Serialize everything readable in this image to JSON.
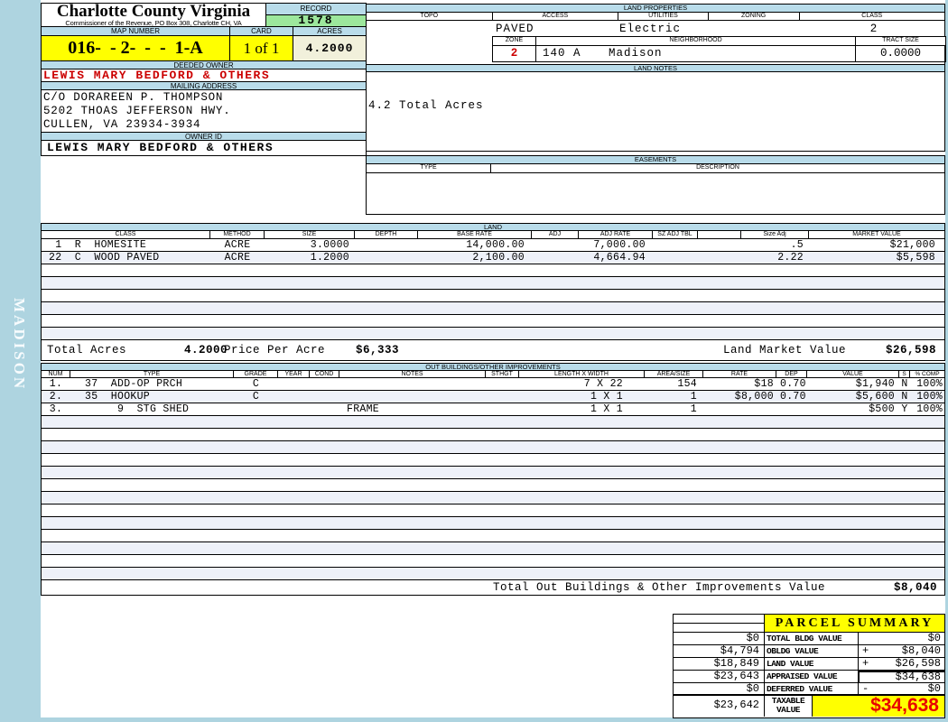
{
  "colors": {
    "page_blue": "#aed4e0",
    "header_strip_blue": "#b9dcea",
    "record_green": "#9ce79c",
    "highlight_yellow": "#ffff00",
    "acres_cream": "#f1f0db",
    "owner_red": "#cc0000",
    "taxable_red": "#e80000",
    "row_stripe": "#eef1f9"
  },
  "sidebar": {
    "district": "MADISON"
  },
  "header": {
    "county": "Charlotte County Virginia",
    "commissioner": "Commissioner of the Revenue, PO Box 308, Charlotte CH, VA",
    "record_label": "RECORD",
    "record_value": "1578",
    "map_number_label": "MAP NUMBER",
    "map_number": "016-  - 2-  -  -  1-A",
    "card_label": "CARD",
    "card_value": "1 of 1",
    "acres_label": "ACRES",
    "acres_value": "4.2000",
    "deeded_owner_label": "DEEDED OWNER",
    "deeded_owner": "LEWIS MARY BEDFORD & OTHERS",
    "mailing_address_label": "MAILING ADDRESS",
    "mailing_address_lines": [
      "C/O DORAREEN P. THOMPSON",
      "5202 THOAS JEFFERSON HWY.",
      "CULLEN, VA 23934-3934"
    ],
    "owner_id_label": "OWNER ID",
    "owner_id": "LEWIS MARY BEDFORD & OTHERS"
  },
  "land_properties": {
    "section_label": "LAND PROPERTIES",
    "headers": [
      "TOPO",
      "ACCESS",
      "UTILITIES",
      "ZONING",
      "CLASS"
    ],
    "topo": "",
    "access": "PAVED",
    "utilities": "Electric",
    "zoning": "",
    "class": "2",
    "zone_label": "ZONE",
    "zone": "2",
    "neighborhood_label": "NEIGHBORHOOD",
    "neighborhood_code": "140 A",
    "neighborhood_name": "Madison",
    "tract_size_label": "TRACT SIZE",
    "tract_size": "0.0000"
  },
  "land_notes": {
    "section_label": "LAND NOTES",
    "note": "4.2 Total Acres"
  },
  "easements": {
    "section_label": "EASEMENTS",
    "type_label": "TYPE",
    "description_label": "DESCRIPTION"
  },
  "land": {
    "section_label": "LAND",
    "headers": [
      "CLASS",
      "METHOD",
      "SIZE",
      "DEPTH",
      "BASE RATE",
      "ADJ",
      "ADJ RATE",
      "SZ ADJ TBL",
      "",
      "Size Adj",
      "MARKET VALUE"
    ],
    "rows": [
      {
        "class": " 1  R  HOMESITE",
        "method": "ACRE",
        "size": "3.0000",
        "depth": "",
        "base_rate": "14,000.00",
        "adj": "",
        "adj_rate": "7,000.00",
        "sz_adj_tbl": "",
        "size_adj": ".5",
        "market_value": "$21,000"
      },
      {
        "class": "22  C  WOOD PAVED",
        "method": "ACRE",
        "size": "1.2000",
        "depth": "",
        "base_rate": "2,100.00",
        "adj": "",
        "adj_rate": "4,664.94",
        "sz_adj_tbl": "",
        "size_adj": "2.22",
        "market_value": "$5,598"
      }
    ],
    "totals": {
      "total_acres_label": "Total Acres",
      "total_acres": "4.2000",
      "price_per_acre_label": "Price Per Acre",
      "price_per_acre": "$6,333",
      "land_market_value_label": "Land Market Value",
      "land_market_value": "$26,598"
    }
  },
  "out_buildings": {
    "section_label": "OUT BUILDINGS/OTHER IMPROVEMENTS",
    "headers": [
      "NUM",
      "TYPE",
      "GRADE",
      "YEAR",
      "COND",
      "NOTES",
      "STHGT",
      "LENGTH X WIDTH",
      "AREA/SIZE",
      "RATE",
      "DEP",
      "VALUE",
      "S",
      "% COMP"
    ],
    "rows": [
      {
        "num": "1.",
        "type": "37  ADD-OP PRCH",
        "grade": "C",
        "year": "",
        "cond": "",
        "notes": "",
        "sthgt": "",
        "lxw": "7 X 22",
        "area": "154",
        "rate": "$18",
        "dep": "0.70",
        "value": "$1,940",
        "s": "N",
        "comp": "100%"
      },
      {
        "num": "2.",
        "type": "35  HOOKUP",
        "grade": "C",
        "year": "",
        "cond": "",
        "notes": "",
        "sthgt": "",
        "lxw": "1 X 1",
        "area": "1",
        "rate": "$8,000",
        "dep": "0.70",
        "value": "$5,600",
        "s": "N",
        "comp": "100%"
      },
      {
        "num": "3.",
        "type": "     9  STG SHED",
        "grade": "",
        "year": "",
        "cond": "",
        "notes": "FRAME",
        "sthgt": "",
        "lxw": "1 X 1",
        "area": "1",
        "rate": "",
        "dep": "",
        "value": "$500",
        "s": "Y",
        "comp": "100%"
      }
    ],
    "total_label": "Total Out Buildings & Other Improvements Value",
    "total_value": "$8,040"
  },
  "parcel_summary": {
    "title": "PARCEL SUMMARY",
    "rows": [
      {
        "left": "$0",
        "label": "TOTAL BLDG VALUE",
        "op": "",
        "value": "$0"
      },
      {
        "left": "$4,794",
        "label": "OBLDG VALUE",
        "op": "+",
        "value": "$8,040"
      },
      {
        "left": "$18,849",
        "label": "LAND VALUE",
        "op": "+",
        "value": "$26,598"
      },
      {
        "left": "$23,643",
        "label": "APPRAISED VALUE",
        "op": "",
        "value": "$34,638"
      },
      {
        "left": "$0",
        "label": "DEFERRED VALUE",
        "op": "-",
        "value": "$0"
      }
    ],
    "taxable": {
      "left": "$23,642",
      "label_line1": "TAXABLE",
      "label_line2": "VALUE",
      "value": "$34,638"
    }
  }
}
